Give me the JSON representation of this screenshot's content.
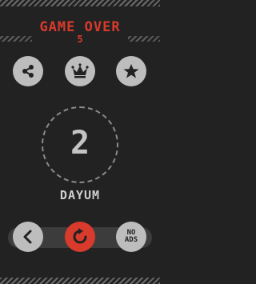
{
  "header": {
    "title": "GAME OVER",
    "score": "5"
  },
  "center": {
    "score": "2",
    "message": "DAYUM"
  },
  "buttons": {
    "share": "share-icon",
    "leaderboard": "crown-icon",
    "rate": "star-icon",
    "back": "chevron-left-icon",
    "restart": "restart-icon",
    "no_ads": "NO ADS"
  },
  "colors": {
    "background": "#222222",
    "accent": "#d83a2c",
    "button": "#bdbdbd",
    "text_light": "#c4c4c4"
  }
}
